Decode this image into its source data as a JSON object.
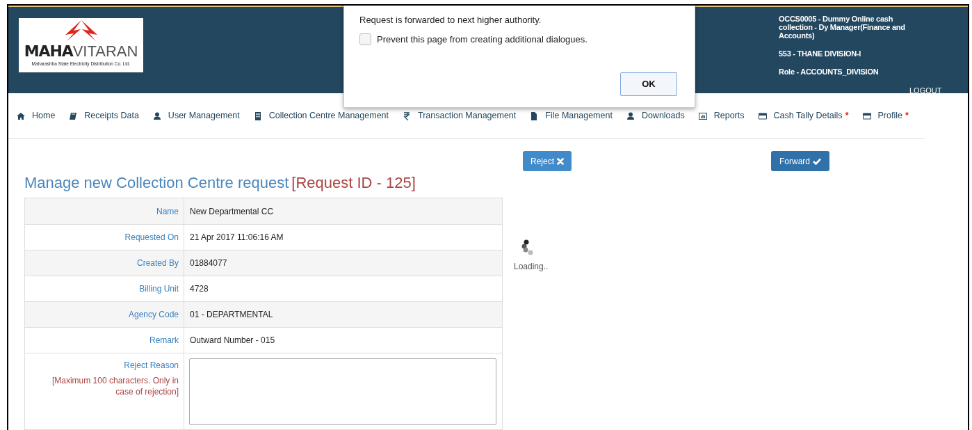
{
  "logo": {
    "brand_bold": "MAHA",
    "brand_light": "VITARAN",
    "tagline": "Maharashtra State Electricity Distribution Co. Ltd."
  },
  "user_info": {
    "lines": [
      "OCCS0005 - Dummy Online cash collection - Dy Manager(Finance and Accounts)",
      "553 - THANE DIVISION-I",
      "Role - ACCOUNTS_DIVISION"
    ],
    "logout": "LOGOUT"
  },
  "dialog": {
    "message": "Request is forwarded to next higher authority.",
    "checkbox": {
      "label": "Prevent this page from creating additional dialogues.",
      "checked": false
    },
    "button": "OK"
  },
  "nav": [
    {
      "label": "Home",
      "kind": "home"
    },
    {
      "label": "Receipts Data",
      "kind": "book"
    },
    {
      "label": "User Management",
      "kind": "user"
    },
    {
      "label": "Collection Centre Management",
      "kind": "building"
    },
    {
      "label": "Transaction Management",
      "kind": "rupee"
    },
    {
      "label": "File Management",
      "kind": "file"
    },
    {
      "label": "Downloads",
      "kind": "user"
    },
    {
      "label": "Reports",
      "kind": "chart"
    },
    {
      "label": "Cash Tally Details",
      "kind": "card",
      "marker": "*"
    },
    {
      "label": "Profile",
      "kind": "card",
      "marker": "*"
    }
  ],
  "page": {
    "title": "Manage new Collection Centre request",
    "request_id": "[Request ID - 125]"
  },
  "actions": [
    {
      "label": "Reject",
      "kind": "reject"
    },
    {
      "label": "Forward",
      "kind": "forward"
    }
  ],
  "details": [
    {
      "label": "Name",
      "value": "New Departmental CC"
    },
    {
      "label": "Requested On",
      "value": "21 Apr 2017 11:06:16 AM"
    },
    {
      "label": "Created By",
      "value": "01884077"
    },
    {
      "label": "Billing Unit",
      "value": "4728"
    },
    {
      "label": "Agency Code",
      "value": "01 - DEPARTMENTAL"
    },
    {
      "label": "Remark",
      "value": "Outward Number - 015"
    }
  ],
  "reject_reason": {
    "label": "Reject Reason",
    "note": "[Maximum 100 characters. Only in case of rejection]"
  },
  "loading": "Loading.."
}
